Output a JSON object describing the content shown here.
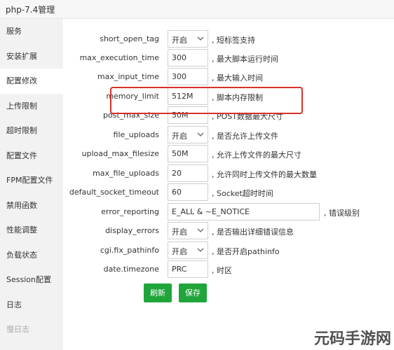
{
  "window": {
    "title": "php-7.4管理"
  },
  "sidebar": {
    "items": [
      {
        "label": "服务"
      },
      {
        "label": "安装扩展"
      },
      {
        "label": "配置修改"
      },
      {
        "label": "上传限制"
      },
      {
        "label": "超时限制"
      },
      {
        "label": "配置文件"
      },
      {
        "label": "FPM配置文件"
      },
      {
        "label": "禁用函数"
      },
      {
        "label": "性能调整"
      },
      {
        "label": "负载状态"
      },
      {
        "label": "Session配置"
      },
      {
        "label": "日志"
      },
      {
        "label": "慢日志"
      }
    ],
    "active_index": 2
  },
  "settings": [
    {
      "key": "short_open_tag",
      "value": "开启",
      "desc": ", 短标签支持"
    },
    {
      "key": "max_execution_time",
      "value": "300",
      "desc": ", 最大脚本运行时间"
    },
    {
      "key": "max_input_time",
      "value": "300",
      "desc": ", 最大输入时间"
    },
    {
      "key": "memory_limit",
      "value": "512M",
      "desc": ", 脚本内存限制"
    },
    {
      "key": "post_max_size",
      "value": "50M",
      "desc": ", POST数据最大尺寸"
    },
    {
      "key": "file_uploads",
      "value": "开启",
      "desc": ", 是否允许上传文件"
    },
    {
      "key": "upload_max_filesize",
      "value": "50M",
      "desc": ", 允许上传文件的最大尺寸"
    },
    {
      "key": "max_file_uploads",
      "value": "20",
      "desc": ", 允许同时上传文件的最大数量"
    },
    {
      "key": "default_socket_timeout",
      "value": "60",
      "desc": ", Socket超时时间"
    },
    {
      "key": "error_reporting",
      "value": "E_ALL & ~E_NOTICE",
      "desc": ", 错误级别"
    },
    {
      "key": "display_errors",
      "value": "开启",
      "desc": ", 是否输出详细错误信息"
    },
    {
      "key": "cgi.fix_pathinfo",
      "value": "开启",
      "desc": ", 是否开启pathinfo"
    },
    {
      "key": "date.timezone",
      "value": "PRC",
      "desc": ", 时区"
    }
  ],
  "buttons": {
    "refresh": "刷新",
    "save": "保存"
  },
  "watermark": {
    "text": "元码手游网"
  },
  "colors": {
    "accent": "#20a53a",
    "highlight": "#d9302c"
  }
}
